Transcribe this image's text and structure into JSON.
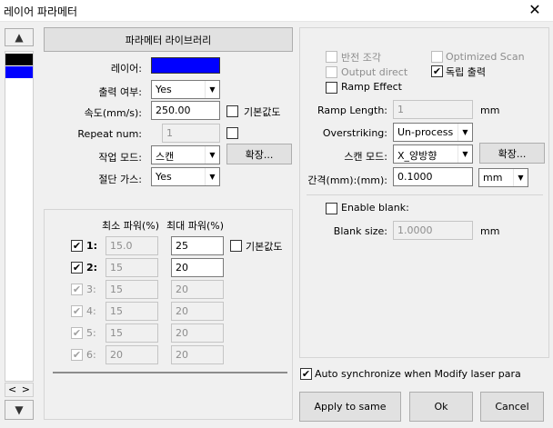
{
  "window": {
    "title": "레이어 파라메터",
    "close_glyph": "✕"
  },
  "left_panel": {
    "colors": [
      "#000000",
      "#0000ff"
    ],
    "scroll_up": "▲",
    "scroll_down": "▼",
    "nav_left": "<",
    "nav_right": ">"
  },
  "main": {
    "library_button": "파라메터 라이브러리",
    "layer_label": "레이어:",
    "layer_color": "#0000ff",
    "output_label": "출력 여부:",
    "output_value": "Yes",
    "speed_label": "속도(mm/s):",
    "speed_value": "250.00",
    "default_label": "기본값도",
    "repeat_label": "Repeat num:",
    "repeat_value": "1",
    "mode_label": "작업 모드:",
    "mode_value": "스캔",
    "expand_button": "확장...",
    "gas_label": "절단 가스:",
    "gas_value": "Yes"
  },
  "power": {
    "min_header": "최소 파워(%)",
    "max_header": "최대 파워(%)",
    "default_label": "기본값도",
    "rows": [
      {
        "label": "1:",
        "checked": "✔",
        "enabled": true,
        "min": "15.0",
        "max": "25"
      },
      {
        "label": "2:",
        "checked": "✔",
        "enabled": true,
        "min": "15",
        "max": "20"
      },
      {
        "label": "3:",
        "checked": "✔",
        "enabled": false,
        "min": "15",
        "max": "20"
      },
      {
        "label": "4:",
        "checked": "✔",
        "enabled": false,
        "min": "15",
        "max": "20"
      },
      {
        "label": "5:",
        "checked": "✔",
        "enabled": false,
        "min": "15",
        "max": "20"
      },
      {
        "label": "6:",
        "checked": "✔",
        "enabled": false,
        "min": "20",
        "max": "20"
      }
    ]
  },
  "scan": {
    "reverse_label": "반전 조각",
    "optimized_label": "Optimized Scan",
    "output_direct_label": "Output direct",
    "independent_label": "독립 출력",
    "independent_checked": "✔",
    "ramp_effect_label": "Ramp Effect",
    "ramp_length_label": "Ramp Length:",
    "ramp_length_value": "1",
    "ramp_unit": "mm",
    "overstriking_label": "Overstriking:",
    "overstriking_value": "Un-process",
    "scan_mode_label": "스캔 모드:",
    "scan_mode_value": "X_양방향",
    "expand_button": "확장...",
    "interval_label": "간격(mm):(mm):",
    "interval_value": "0.1000",
    "interval_unit": "mm",
    "enable_blank_label": "Enable blank:",
    "blank_size_label": "Blank size:",
    "blank_size_value": "1.0000",
    "blank_unit": "mm"
  },
  "footer": {
    "auto_sync_label": "Auto synchronize when Modify laser para",
    "auto_sync_checked": "✔",
    "apply_button": "Apply to same",
    "ok_button": "Ok",
    "cancel_button": "Cancel"
  }
}
